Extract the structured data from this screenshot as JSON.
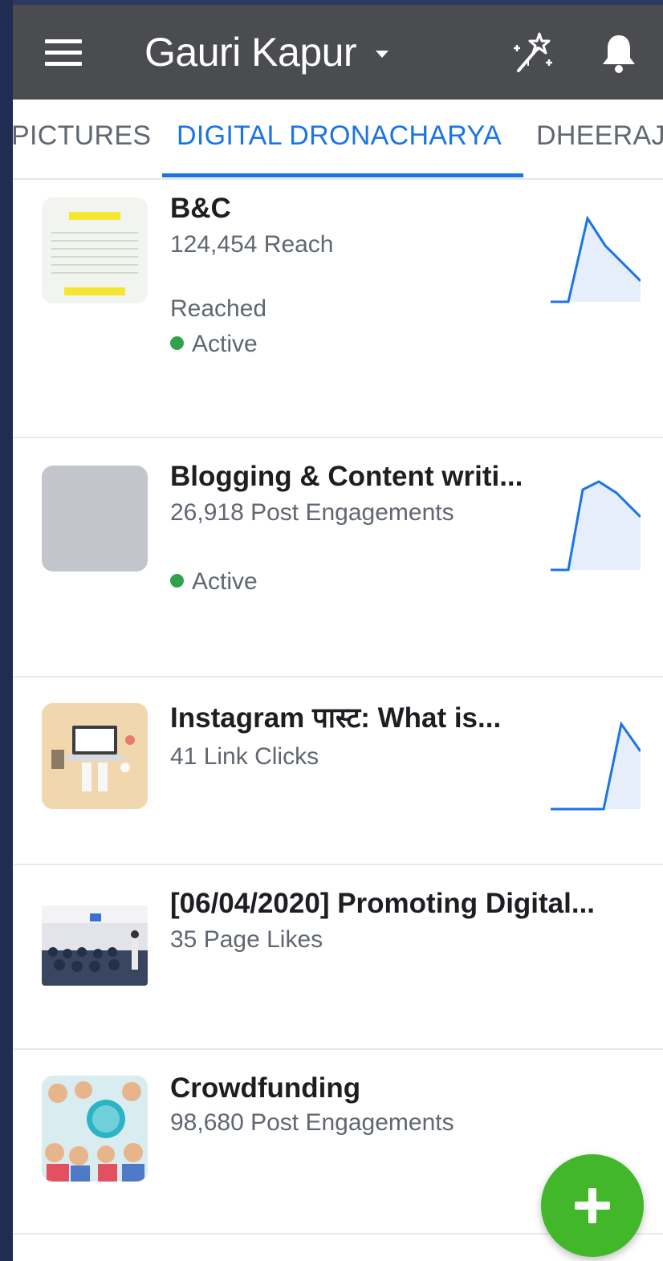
{
  "header": {
    "account_name": "Gauri Kapur",
    "icons": [
      "menu-icon",
      "magic-wand-icon",
      "notification-bell-icon"
    ]
  },
  "tabs": [
    {
      "label": "PICTURES",
      "active": false
    },
    {
      "label": "DIGITAL DRONACHARYA",
      "active": true
    },
    {
      "label": "DHEERAJ",
      "active": false
    }
  ],
  "campaigns": [
    {
      "title": "B&C",
      "metric": "124,454 Reach",
      "subtext": "Reached",
      "status": "Active"
    },
    {
      "title": "Blogging & Content writi...",
      "metric": "26,918 Post Engagements",
      "status": "Active"
    },
    {
      "title": "Instagram पास्ट: What is...",
      "metric": "41 Link Clicks"
    },
    {
      "title": "[06/04/2020] Promoting Digital...",
      "metric": "35 Page Likes"
    },
    {
      "title": "Crowdfunding",
      "metric": "98,680 Post Engagements"
    }
  ],
  "colors": {
    "header_bg": "#4b4c4f",
    "active_tab": "#1b74e4",
    "status_active": "#31a24c",
    "fab": "#42b72a",
    "sparkline": "#1b74e4"
  }
}
